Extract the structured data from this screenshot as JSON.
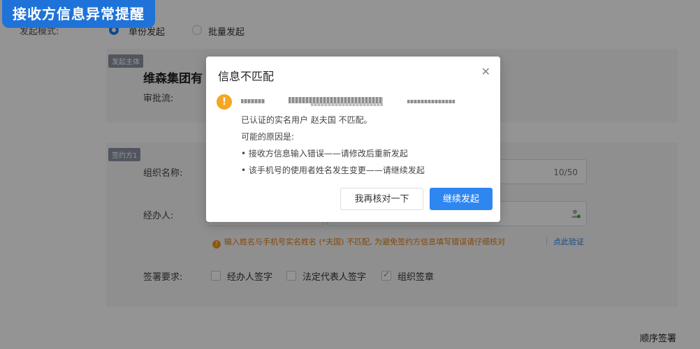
{
  "banner": {
    "title": "接收方信息异常提醒"
  },
  "form": {
    "mode_label": "发起模式:",
    "mode_options": [
      {
        "label": "单份发起",
        "selected": true
      },
      {
        "label": "批量发起",
        "selected": false
      }
    ],
    "initiator": {
      "tag": "发起主体",
      "company_name": "维森集团有",
      "approval_label": "审批流:"
    },
    "signer": {
      "tag": "签约方1",
      "org_name_label": "组织名称:",
      "org_name_counter": "10/50",
      "handler_label": "经办人:",
      "warning_text": "输入姓名与手机号实名姓名 (*夫国) 不匹配, 为避免签约方信息填写错误请仔细核对",
      "verify_link": "点此验证",
      "sign_req_label": "签署要求:",
      "sign_options": [
        {
          "label": "经办人签字",
          "checked": false
        },
        {
          "label": "法定代表人签字",
          "checked": false
        },
        {
          "label": "组织签章",
          "checked": true
        }
      ]
    },
    "sequential_sign": "顺序签署"
  },
  "modal": {
    "title": "信息不匹配",
    "close_icon": "close-icon",
    "alert_icon": "warning-icon",
    "lines": [
      "已认证的实名用户 赵夫国 不匹配。",
      "可能的原因是:",
      "• 接收方信息输入错误——请修改后重新发起",
      "• 该手机号的使用者姓名发生变更——请继续发起"
    ],
    "btn_recheck": "我再核对一下",
    "btn_continue": "继续发起"
  },
  "colors": {
    "banner": "#1f73d8",
    "primary": "#2e86f0",
    "warning": "#f5a623",
    "link": "#1e7ef0"
  }
}
